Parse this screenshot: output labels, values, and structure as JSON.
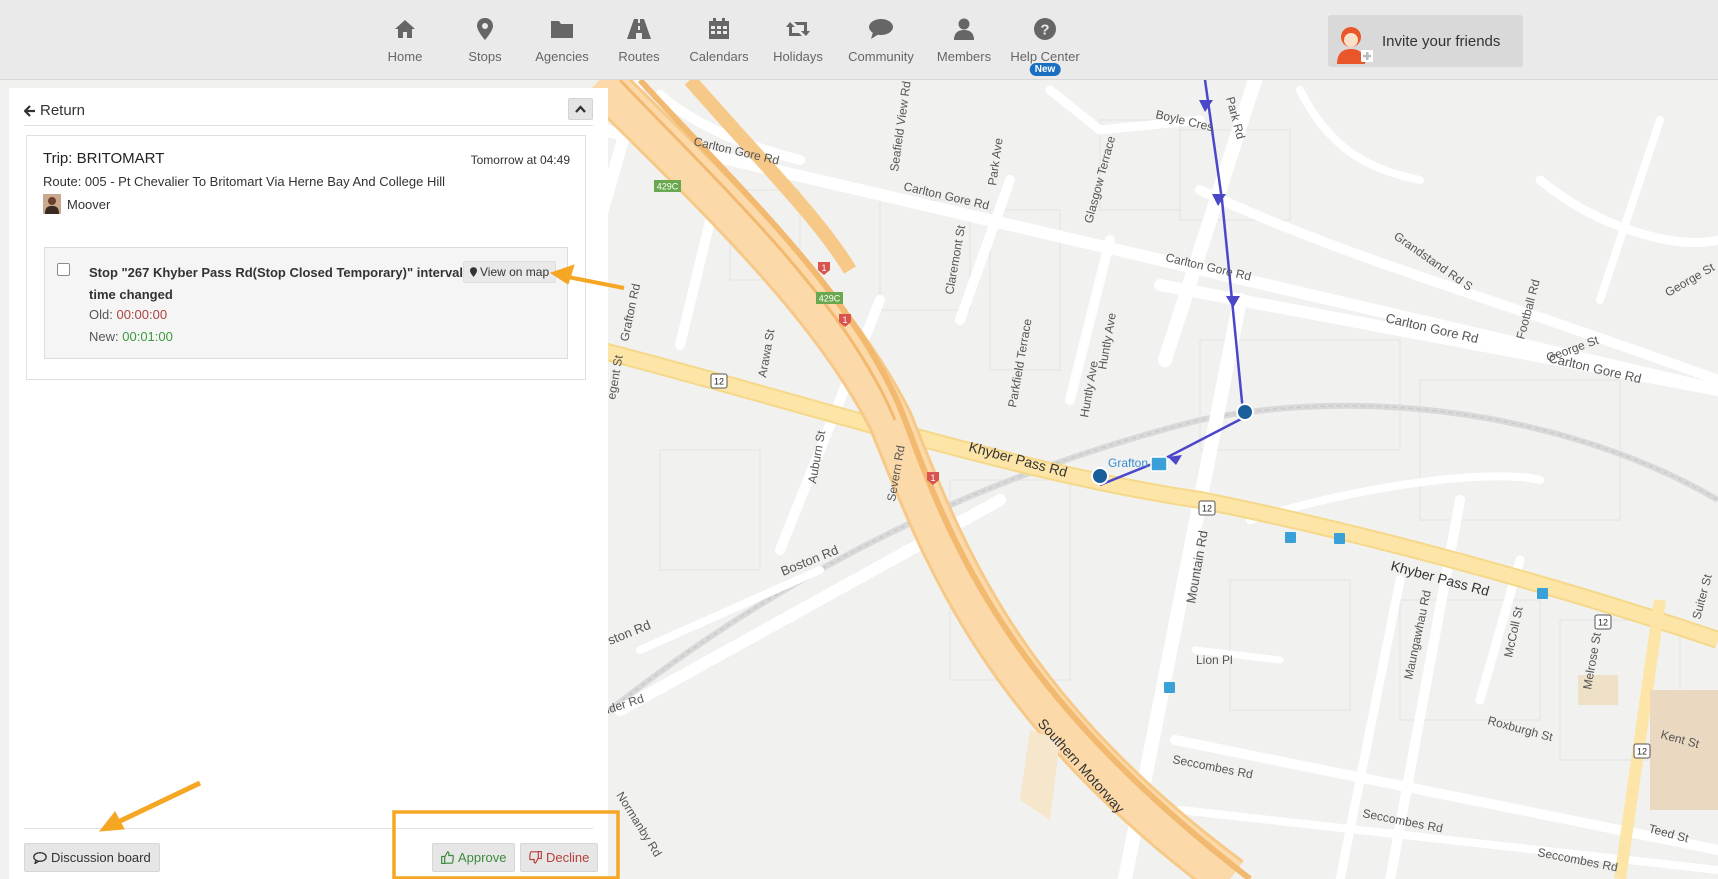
{
  "nav": {
    "items": [
      {
        "label": "Home",
        "icon": "home-icon"
      },
      {
        "label": "Stops",
        "icon": "map-marker-icon"
      },
      {
        "label": "Agencies",
        "icon": "folder-icon"
      },
      {
        "label": "Routes",
        "icon": "road-icon"
      },
      {
        "label": "Calendars",
        "icon": "calendar-icon"
      },
      {
        "label": "Holidays",
        "icon": "retweet-icon"
      },
      {
        "label": "Community",
        "icon": "speech-bubble-icon"
      },
      {
        "label": "Members",
        "icon": "user-icon"
      },
      {
        "label": "Help Center",
        "icon": "question-circle-icon",
        "badge": "New"
      }
    ],
    "invite_label": "Invite your friends"
  },
  "panel": {
    "return_label": "Return",
    "trip": {
      "title": "Trip: BRITOMART",
      "when": "Tomorrow at 04:49",
      "route": "Route: 005 - Pt Chevalier To Britomart Via Herne Bay And College Hill",
      "user": "Moover"
    },
    "change": {
      "text": "Stop \"267 Khyber Pass Rd(Stop Closed Temporary)\" interval time changed",
      "old_label": "Old:",
      "old_value": "00:00:00",
      "new_label": "New:",
      "new_value": "00:01:00",
      "view_map_label": "View on map"
    },
    "footer": {
      "discussion_label": "Discussion board",
      "approve_label": "Approve",
      "decline_label": "Decline"
    }
  },
  "map": {
    "labels": {
      "carlton_gore_1": "Carlton Gore Rd",
      "carlton_gore_2": "Carlton Gore Rd",
      "carlton_gore_3": "Carlton Gore Rd",
      "carlton_gore_4": "Carlton Gore Rd",
      "carlton_gore_5": "Carlton Gore Rd",
      "khyber_1": "Khyber Pass Rd",
      "khyber_2": "Khyber Pass Rd",
      "grafton_rd": "Grafton Rd",
      "boston_rd": "Boston Rd",
      "boston_rd_2": "ston Rd",
      "mountain_rd": "Mountain Rd",
      "southern_mwy": "Southern Motorway",
      "seccombes_1": "Seccombes Rd",
      "seccombes_2": "Seccombes Rd",
      "seccombes_3": "Seccombes Rd",
      "park_rd": "Park Rd",
      "boyle_cres": "Boyle Cres",
      "glasgow_tce": "Glasgow Terrace",
      "seafield": "Seafield View Rd",
      "park_ave": "Park Ave",
      "claremont": "Claremont St",
      "parkfield": "Parkfield Terrace",
      "huntly_ave": "Huntly Ave",
      "huntly_ave_2": "Huntly Ave",
      "arawa": "Arawa St",
      "auburn": "Auburn St",
      "severn": "Severn Rd",
      "grafton_stn": "Grafton",
      "lion_pl": "Lion Pl",
      "maungawhau": "Maungawhau Rd",
      "mccoll": "McColl St",
      "melrose": "Melrose St",
      "roxburgh": "Roxburgh St",
      "kent": "Kent St",
      "teed": "Teed St",
      "george_1": "George St",
      "george_2": "George St",
      "football": "Football Rd",
      "grandstand": "Grandstand Rd S",
      "suiter": "Suiter St",
      "normanby": "Normanby Rd",
      "uder": "uder Rd",
      "egent": "egent St",
      "shield_429c": "429C",
      "shield_12": "12",
      "shield_1": "1"
    }
  },
  "colors": {
    "motorway": "#fcd6a4",
    "primary_road": "#fde293",
    "route_line": "#4a47c8",
    "annotation": "#f5a623"
  }
}
